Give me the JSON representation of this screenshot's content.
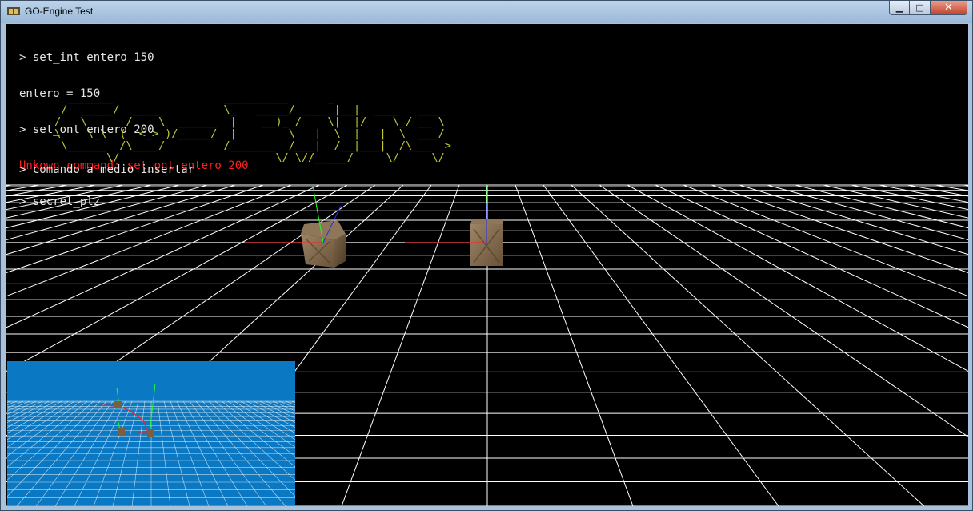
{
  "window": {
    "title": "GO-Engine Test",
    "controls": {
      "minimize": "▁",
      "maximize": "□",
      "close": "✕"
    }
  },
  "console": {
    "lines": [
      {
        "text": "> set_int entero 150",
        "type": "input"
      },
      {
        "text": "entero = 150",
        "type": "output"
      },
      {
        "text": "> set_ont entero 200",
        "type": "input"
      },
      {
        "text": "Unkown command: set_ont entero 200",
        "type": "error"
      },
      {
        "text": "> secret_plz",
        "type": "input"
      }
    ],
    "ascii_art": "   _______                 __________      _\n  /  _____/  ____          \\_   _____/ ____ |__|  ____   ____\n /   \\  ___ /  _ \\  ______  |    __)_ /    \\|  |/    \\_/ __ \\\n \\    \\_\\  (  <_> )/_____/  |        \\   |  \\  |   |  \\  ___/\n  \\______  /\\____/         /_______  /___|  /__|___|  /\\___  >\n         \\/                        \\/ \\//_____/     \\/     \\/",
    "current_input": "> comando a medio insertar"
  },
  "colors": {
    "console_text": "#e6e6e6",
    "error_text": "#ff2020",
    "ascii_art": "#c4c832",
    "grid_line": "#ffffff",
    "minimap_sky": "#0a78c2",
    "axis_x": "#ff2020",
    "axis_y": "#20ff20",
    "axis_z": "#2030ff",
    "crate": "#8a7258"
  },
  "scene": {
    "objects": [
      {
        "name": "crate-left"
      },
      {
        "name": "crate-right"
      }
    ]
  }
}
